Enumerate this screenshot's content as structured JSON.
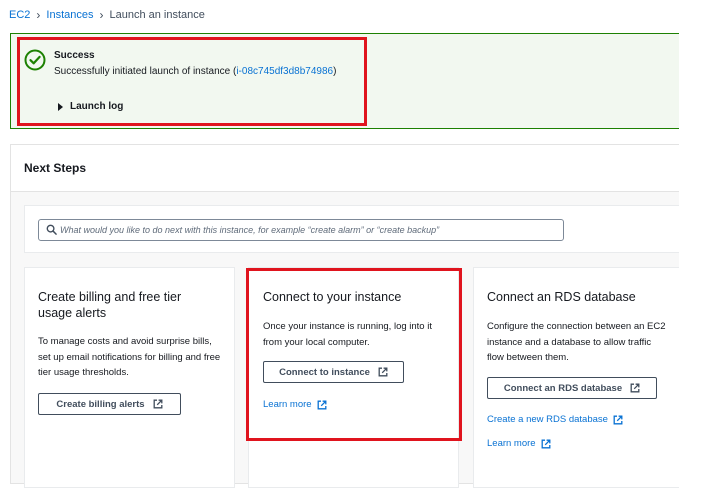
{
  "breadcrumb": {
    "items": [
      "EC2",
      "Instances",
      "Launch an instance"
    ]
  },
  "banner": {
    "title": "Success",
    "message_prefix": "Successfully initiated launch of instance (",
    "instance_id": "i-08c745df3d8b74986",
    "message_suffix": ")",
    "launch_log_label": "Launch log",
    "status_color": "#1d8102"
  },
  "next_steps": {
    "title": "Next Steps",
    "search_placeholder": "What would you like to do next with this instance, for example “create alarm” or “create backup”"
  },
  "cards": {
    "billing": {
      "title": "Create billing and free tier usage alerts",
      "description": "To manage costs and avoid surprise bills, set up email notifications for billing and free tier usage thresholds.",
      "button_label": "Create billing alerts"
    },
    "connect": {
      "title": "Connect to your instance",
      "description": "Once your instance is running, log into it from your local computer.",
      "button_label": "Connect to instance",
      "learn_more": "Learn more"
    },
    "rds": {
      "title": "Connect an RDS database",
      "description": "Configure the connection between an EC2 instance and a database to allow traffic flow between them.",
      "button_label": "Connect an RDS database",
      "create_link": "Create a new RDS database",
      "learn_more": "Learn more"
    }
  },
  "colors": {
    "link": "#0972d3",
    "highlight": "#e0141e",
    "success_bg": "#f2f8f0"
  }
}
